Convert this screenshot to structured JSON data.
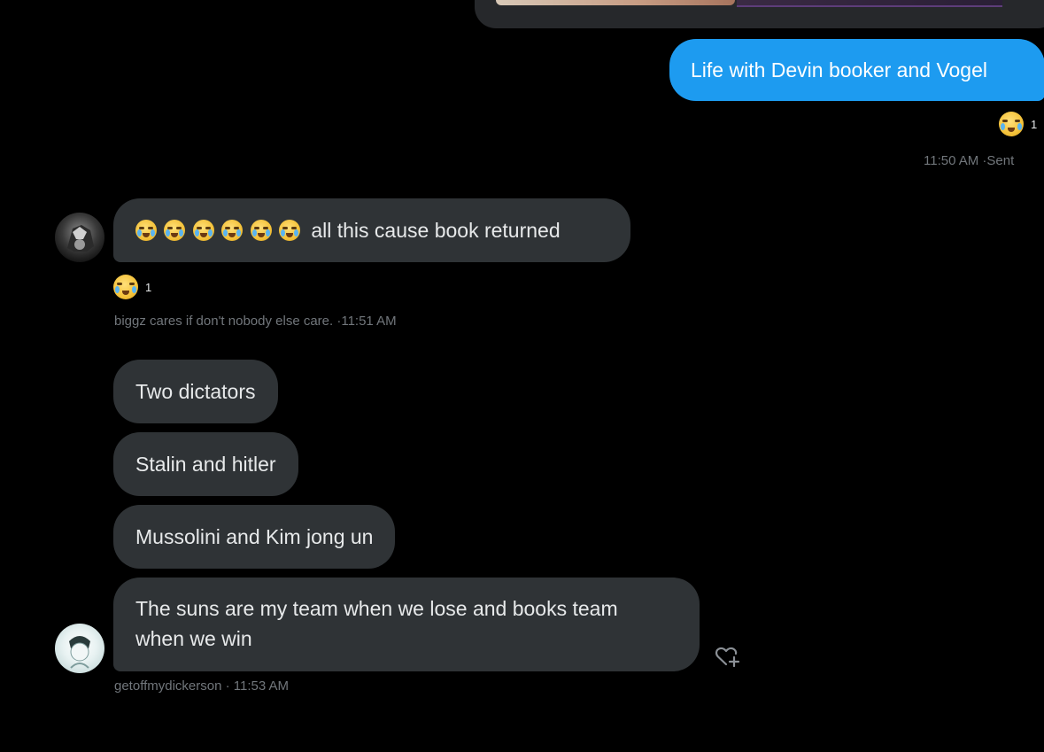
{
  "messages": {
    "sent": {
      "text": "Life with Devin booker and Vogel",
      "reaction_count": "1",
      "meta": "11:50 AM ·Sent"
    },
    "reply1": {
      "text": "all this cause book returned",
      "reaction_count": "1",
      "meta": "biggz cares if don't nobody else care. ·11:51 AM"
    },
    "reply2": {
      "bubbles": [
        "Two dictators",
        "Stalin and hitler",
        "Mussolini and Kim jong un"
      ]
    },
    "reply3": {
      "line1": "The suns are my team when we lose and books team",
      "line2": "when we win",
      "meta": "getoffmydickerson · 11:53 AM"
    }
  },
  "icons": {
    "laugh_cry": "face-with-tears-of-joy-icon",
    "react_add": "heart-plus-icon"
  },
  "colors": {
    "background": "#000000",
    "sent_bubble": "#1d9bf0",
    "received_bubble": "#2f3336",
    "meta_text": "#71767b"
  }
}
